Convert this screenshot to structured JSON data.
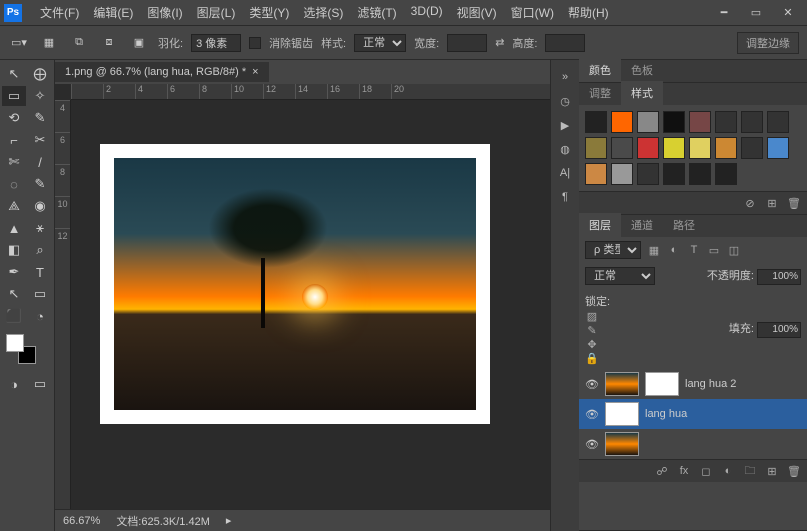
{
  "app": {
    "logo": "Ps"
  },
  "menu": [
    "文件(F)",
    "编辑(E)",
    "图像(I)",
    "图层(L)",
    "类型(Y)",
    "选择(S)",
    "滤镜(T)",
    "3D(D)",
    "视图(V)",
    "窗口(W)",
    "帮助(H)"
  ],
  "options": {
    "feather_label": "羽化:",
    "feather_value": "3 像素",
    "antialias": "消除锯齿",
    "style_label": "样式:",
    "style_value": "正常",
    "width_label": "宽度:",
    "height_label": "高度:",
    "refine": "调整边缘"
  },
  "document": {
    "tab_title": "1.png @ 66.7% (lang hua, RGB/8#) *",
    "zoom": "66.67%",
    "doc_label": "文档:",
    "doc_size": "625.3K/1.42M"
  },
  "ruler_h": [
    "",
    "2",
    "4",
    "6",
    "8",
    "10",
    "12",
    "14",
    "16",
    "18",
    "20"
  ],
  "ruler_v": [
    "4",
    "6",
    "8",
    "10",
    "12"
  ],
  "panels": {
    "color_tab": "颜色",
    "swatches_tab": "色板",
    "adjust_tab": "调整",
    "styles_tab": "样式",
    "layers_tab": "图层",
    "channels_tab": "通道",
    "paths_tab": "路径",
    "kind_label": "类型",
    "blend_mode": "正常",
    "opacity_label": "不透明度:",
    "opacity_value": "100%",
    "lock_label": "锁定:",
    "fill_label": "填充:",
    "fill_value": "100%"
  },
  "layers": [
    {
      "name": "lang hua 2",
      "selected": false,
      "hasMask": true
    },
    {
      "name": "lang hua",
      "selected": true,
      "hasMask": false
    }
  ],
  "style_swatches": [
    "#222",
    "#ff6600",
    "#888",
    "#101010",
    "#764646",
    "#333",
    "#333",
    "#333",
    "#8a7a3a",
    "#4a4a4a",
    "#cc3333",
    "#d8d030",
    "#e0d060",
    "#cc8833",
    "#333",
    "#4a88cc",
    "#cc8844",
    "#999",
    "#333",
    "#222",
    "#222",
    "#222"
  ]
}
